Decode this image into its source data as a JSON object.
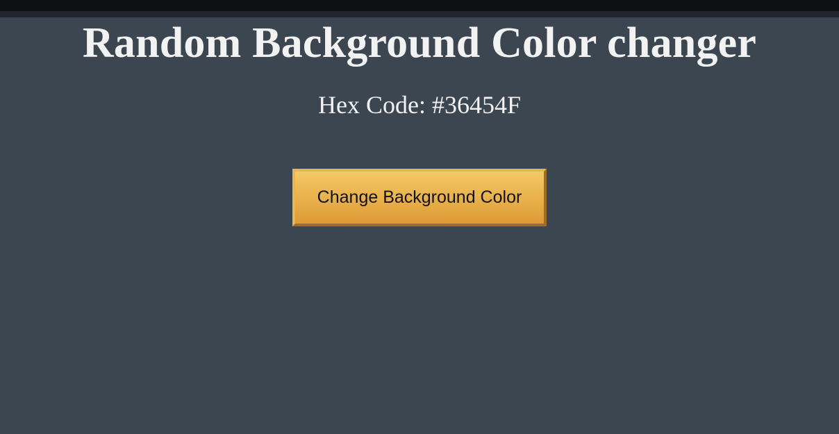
{
  "page": {
    "title": "Random Background Color changer",
    "hex_label": "Hex Code: #36454F",
    "button_label": "Change Background Color"
  },
  "colors": {
    "background": "#3c4650",
    "button": "#e9b24c",
    "text": "#f2f2f2"
  }
}
